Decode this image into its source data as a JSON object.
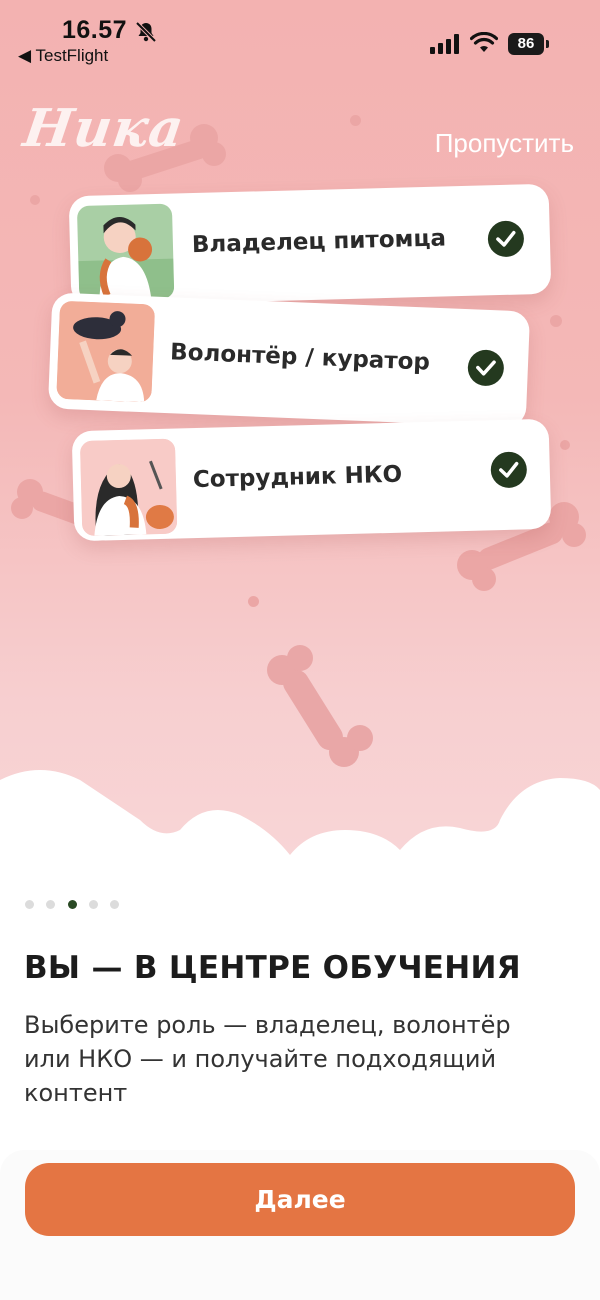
{
  "status_bar": {
    "time": "16.57",
    "back_app": "◀ TestFlight",
    "battery": "86",
    "icons": [
      "bell-slash-icon",
      "signal-icon",
      "wifi-icon",
      "battery-icon"
    ]
  },
  "header": {
    "logo": "Ника",
    "skip_label": "Пропустить"
  },
  "roles": [
    {
      "label": "Владелец питомца",
      "selected": true
    },
    {
      "label": "Волонтёр / куратор",
      "selected": true
    },
    {
      "label": "Сотрудник НКО",
      "selected": true
    }
  ],
  "pager": {
    "total": 5,
    "active": 3
  },
  "main": {
    "title": "ВЫ — В ЦЕНТРЕ ОБУЧЕНИЯ",
    "description": "Выберите роль — владелец, волонтёр\n или НКО — и получайте подходящий\nконтент"
  },
  "footer": {
    "next_label": "Далее"
  },
  "colors": {
    "hero_bg": "#f3b2b1",
    "bone": "#e8a4a4",
    "check": "#24391f",
    "button": "#e47543"
  }
}
